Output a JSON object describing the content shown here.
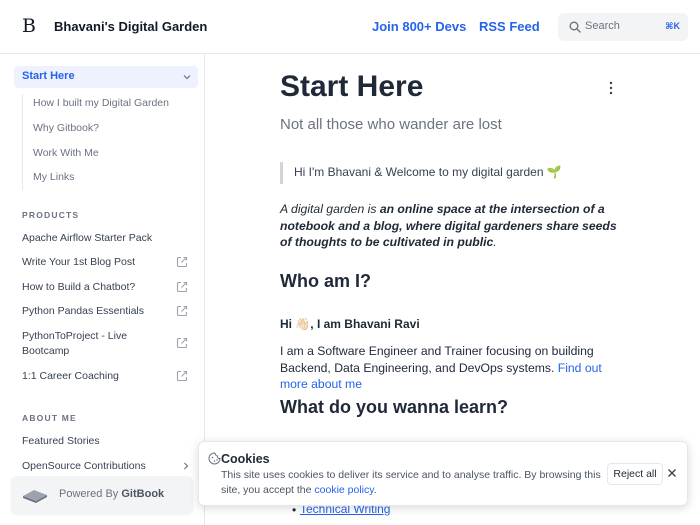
{
  "header": {
    "logo": "B",
    "site_title": "Bhavani's Digital Garden",
    "links": [
      "Join 800+ Devs",
      "RSS Feed"
    ],
    "search_placeholder": "Search",
    "search_shortcut": "⌘K"
  },
  "sidebar": {
    "active_section": "Start Here",
    "sub_items": [
      "How I built my Digital Garden",
      "Why Gitbook?",
      "Work With Me",
      "My Links"
    ],
    "products_heading": "PRODUCTS",
    "products": [
      {
        "label": "Apache Airflow Starter Pack",
        "external": false
      },
      {
        "label": "Write Your 1st Blog Post",
        "external": true
      },
      {
        "label": "How to Build a Chatbot?",
        "external": true
      },
      {
        "label": "Python Pandas Essentials",
        "external": true
      },
      {
        "label": "PythonToProject - Live Bootcamp",
        "external": true
      },
      {
        "label": "1:1 Career Coaching",
        "external": true
      }
    ],
    "about_heading": "ABOUT ME",
    "about_items": [
      {
        "label": "Featured Stories"
      },
      {
        "label": "OpenSource Contributions"
      }
    ],
    "powered_prefix": "Powered By ",
    "powered_brand": "GitBook"
  },
  "main": {
    "title": "Start Here",
    "subtitle": "Not all those who wander are lost",
    "hint": "Hi I'm Bhavani & Welcome to my digital garden 🌱",
    "intro_pre": "A digital garden is ",
    "intro_bold": "an online space at the intersection of a notebook and a blog, where digital gardeners share seeds of thoughts to be cultivated in public",
    "intro_post": ".",
    "h2_who": "Who am I?",
    "greeting": "Hi 👋🏻, I am Bhavani Ravi",
    "about_text": "I am a Software Engineer and Trainer focusing on building Backend, Data Engineering, and DevOps systems. ",
    "about_link": "Find out more about me",
    "h2_learn": "What do you wanna learn?",
    "bullet_item": "Technical Writing"
  },
  "cookie": {
    "title": "Cookies",
    "body": "This site uses cookies to deliver its service and to analyse traffic. By browsing this site, you accept the ",
    "link": "cookie policy",
    "body_end": ".",
    "reject": "Reject all"
  },
  "colors": {
    "accent": "#2563eb",
    "active_bg": "#eef2ff",
    "text": "#1f2937",
    "muted": "#6b7280"
  }
}
